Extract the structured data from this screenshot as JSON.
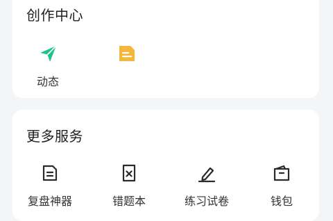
{
  "creation": {
    "title": "创作中心",
    "items": [
      {
        "label": "动态",
        "icon": "send-icon",
        "color": "#1fc28c"
      },
      {
        "label": "",
        "icon": "article-icon",
        "color": "#f5b73b"
      }
    ]
  },
  "services": {
    "title": "更多服务",
    "items": [
      {
        "label": "复盘神器",
        "icon": "document-icon"
      },
      {
        "label": "错题本",
        "icon": "error-book-icon"
      },
      {
        "label": "练习试卷",
        "icon": "pencil-icon"
      },
      {
        "label": "钱包",
        "icon": "wallet-icon"
      }
    ],
    "icon_color": "#2a2a2a"
  }
}
